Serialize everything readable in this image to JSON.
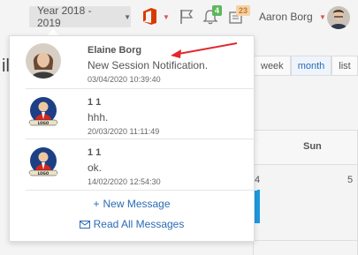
{
  "topbar": {
    "year_label": "Year 2018 - 2019",
    "notifications_badge": "4",
    "notes_badge": "23",
    "user_name": "Aaron Borg"
  },
  "calendar": {
    "partial_letter": "il",
    "views": [
      "week",
      "month",
      "list"
    ],
    "active_view": "month",
    "day_header": "Sun",
    "day_numbers": [
      "4",
      "5"
    ]
  },
  "messages": [
    {
      "sender": "Elaine Borg",
      "text": "New Session Notification.",
      "time": "03/04/2020 10:39:40",
      "avatar": "woman-avatar-icon"
    },
    {
      "sender": "1 1",
      "text": "hhh.",
      "time": "20/03/2020 11:11:49",
      "avatar": "business-logo-avatar-icon"
    },
    {
      "sender": "1 1",
      "text": "ok.",
      "time": "14/02/2020 12:54:30",
      "avatar": "business-logo-avatar-icon"
    }
  ],
  "actions": {
    "new_message": "New Message",
    "read_all": "Read All Messages"
  },
  "colors": {
    "accent": "#2b6bb5",
    "badge_green": "#5cb85c",
    "badge_orange": "#f6d2a7",
    "office": "#d83b01",
    "annotation": "#e0282e"
  }
}
